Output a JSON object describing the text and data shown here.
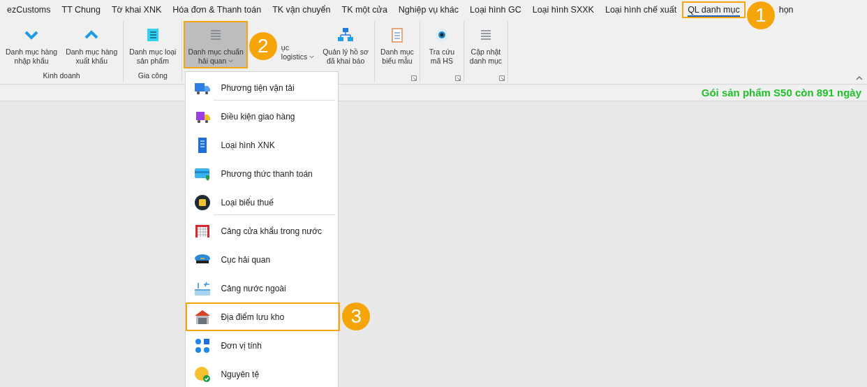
{
  "tabs": [
    {
      "label": "ezCustoms",
      "selected": false
    },
    {
      "label": "TT Chung",
      "selected": false
    },
    {
      "label": "Tờ khai XNK",
      "selected": false
    },
    {
      "label": "Hóa đơn & Thanh toán",
      "selected": false
    },
    {
      "label": "TK vận chuyển",
      "selected": false
    },
    {
      "label": "TK một cửa",
      "selected": false
    },
    {
      "label": "Nghiệp vụ khác",
      "selected": false
    },
    {
      "label": "Loại hình GC",
      "selected": false
    },
    {
      "label": "Loại hình SXXK",
      "selected": false
    },
    {
      "label": "Loại hình chế xuất",
      "selected": false
    },
    {
      "label": "QL danh mục",
      "selected": true,
      "highlighted": true,
      "callout": "1"
    },
    {
      "label": "họn",
      "selected": false
    }
  ],
  "ribbon_groups": [
    {
      "label": "Kinh doanh",
      "buttons": [
        {
          "lines": [
            "Danh mục hàng",
            "nhập khẩu"
          ],
          "pressed": false
        },
        {
          "lines": [
            "Danh mục hàng",
            "xuất khẩu"
          ],
          "pressed": false
        }
      ]
    },
    {
      "label": "Gia công",
      "buttons": [
        {
          "lines": [
            "Danh mục loại",
            "sản phẩm"
          ],
          "pressed": false
        }
      ]
    },
    {
      "buttons": [
        {
          "lines": [
            "Danh mục chuẩn",
            "hải quan"
          ],
          "dropdown": true,
          "pressed": true,
          "highlighted": true,
          "callout": "2"
        },
        {
          "lines": [
            "ục",
            "logistics"
          ],
          "dropdown": true,
          "pressed": false
        },
        {
          "lines": [
            "Quản lý hồ sơ",
            "đã khai báo"
          ],
          "pressed": false
        }
      ]
    },
    {
      "launcher": true,
      "buttons": [
        {
          "lines": [
            "Danh mục",
            "biểu mẫu"
          ],
          "pressed": false
        }
      ]
    },
    {
      "launcher": true,
      "buttons": [
        {
          "lines": [
            "Tra cứu",
            "mã HS"
          ],
          "pressed": false
        }
      ]
    },
    {
      "launcher": true,
      "buttons": [
        {
          "lines": [
            "Cập nhật",
            "danh mục"
          ],
          "pressed": false
        }
      ]
    }
  ],
  "status": "Gói sản phẩm S50 còn 891 ngày",
  "menu": {
    "items": [
      {
        "label": "Phương tiện vận tải",
        "separator_after": true,
        "selected": false
      },
      {
        "label": "Điều kiện giao hàng",
        "separator_after": false,
        "selected": false
      },
      {
        "label": "Loại hình XNK",
        "separator_after": false,
        "selected": false
      },
      {
        "label": "Phương thức thanh toán",
        "separator_after": false,
        "selected": false
      },
      {
        "label": "Loại biểu thuế",
        "separator_after": true,
        "selected": false
      },
      {
        "label": "Cảng cửa khẩu trong nước",
        "separator_after": false,
        "selected": false
      },
      {
        "label": "Cục hải quan",
        "separator_after": false,
        "selected": false
      },
      {
        "label": "Cảng nước ngoài",
        "separator_after": false,
        "selected": false
      },
      {
        "label": "Địa điểm lưu kho",
        "separator_after": false,
        "selected": true,
        "callout": "3"
      },
      {
        "label": "Đơn vị tính",
        "separator_after": false,
        "selected": false
      },
      {
        "label": "Nguyên tệ",
        "separator_after": false,
        "selected": false
      }
    ]
  }
}
